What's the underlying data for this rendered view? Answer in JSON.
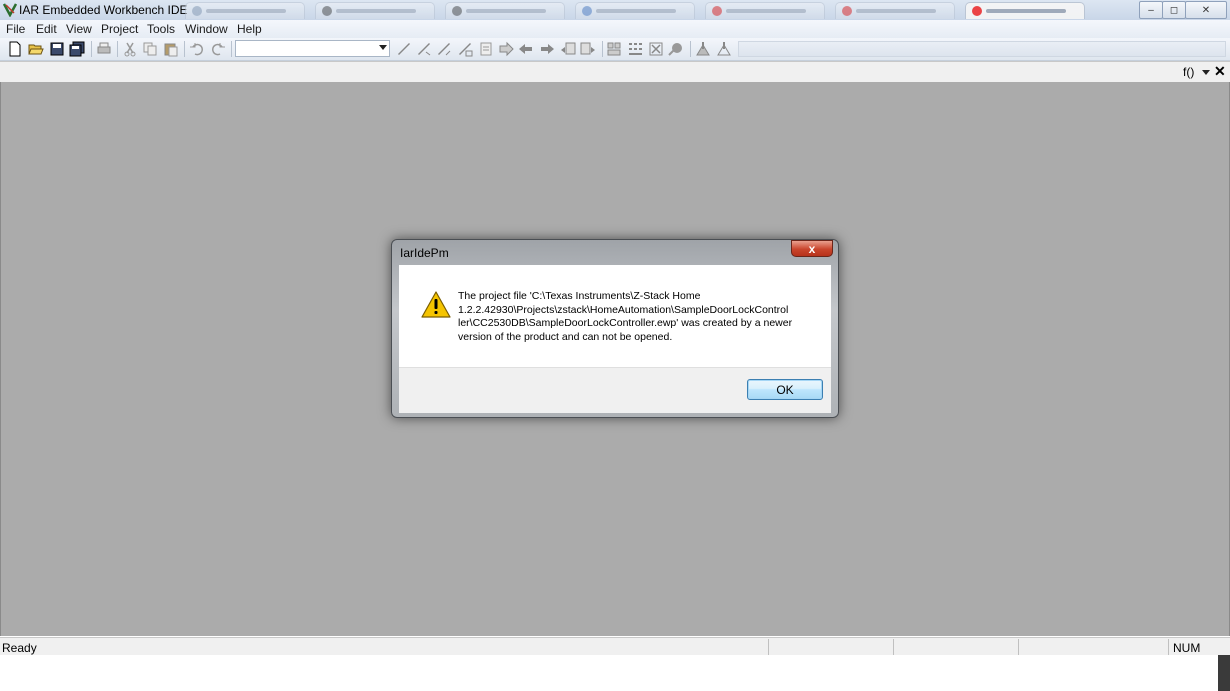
{
  "window": {
    "title": "IAR Embedded Workbench IDE",
    "minimize_glyph": "–",
    "maximize_glyph": "◻",
    "close_glyph": "✕"
  },
  "menu": [
    "File",
    "Edit",
    "View",
    "Project",
    "Tools",
    "Window",
    "Help"
  ],
  "editor": {
    "function_label": "f()",
    "close_glyph": "✕"
  },
  "status": {
    "text": "Ready",
    "num": "NUM"
  },
  "dialog": {
    "title": "IarIdePm",
    "close_glyph": "x",
    "message": "The project file 'C:\\Texas Instruments\\Z-Stack Home\n1.2.2.42930\\Projects\\zstack\\HomeAutomation\\SampleDoorLockControl\nler\\CC2530DB\\SampleDoorLockController.ewp' was created by a newer\nversion of the product and can not be opened.",
    "ok_label": "OK",
    "icon": "warning-icon"
  },
  "colors": {
    "workspace": "#ababab",
    "warning": "#f5c400",
    "dialog_close": "#c9452c"
  }
}
